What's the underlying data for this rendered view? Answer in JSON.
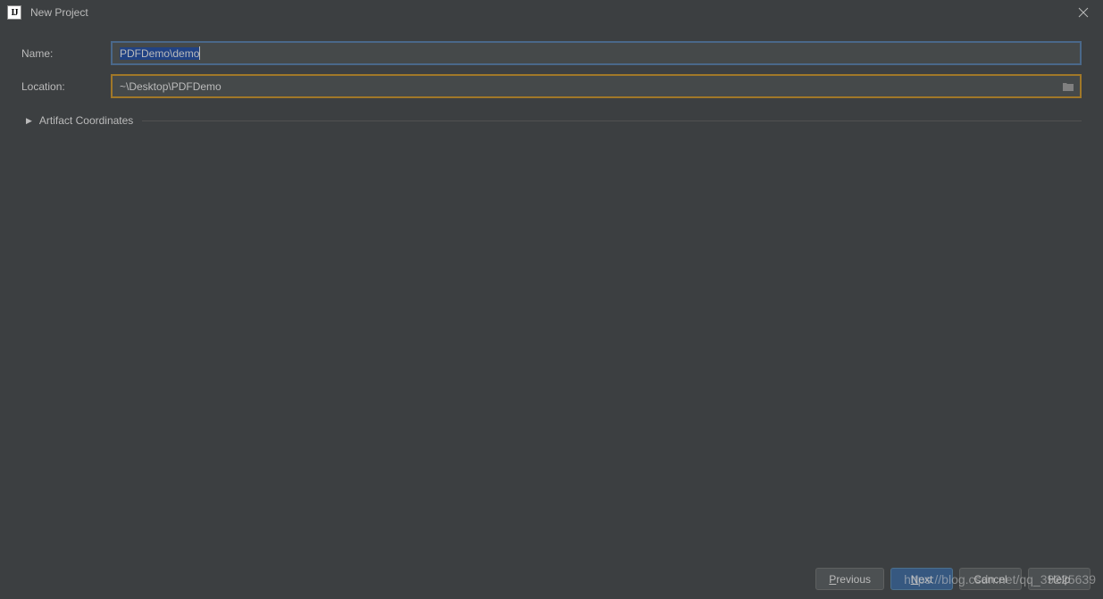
{
  "window": {
    "title": "New Project"
  },
  "form": {
    "name_label": "Name:",
    "name_value": "PDFDemo\\demo",
    "location_label": "Location:",
    "location_value": "~\\Desktop\\PDFDemo"
  },
  "sections": {
    "artifact_coordinates": "Artifact Coordinates"
  },
  "buttons": {
    "previous": "Previous",
    "next": "Next",
    "cancel": "Cancel",
    "help": "Help"
  },
  "watermark": "https://blog.csdn.net/qq_39225639"
}
